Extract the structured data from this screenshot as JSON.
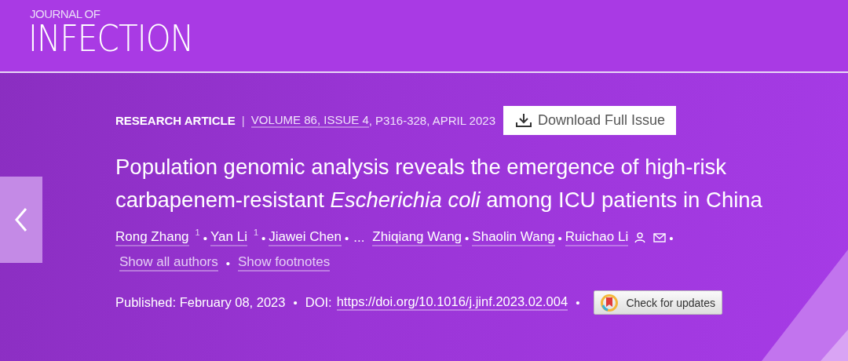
{
  "journal": {
    "small": "JOURNAL OF",
    "name": "INFECTION"
  },
  "article": {
    "type": "RESEARCH ARTICLE",
    "separator": "|",
    "issue": "VOLUME 86, ISSUE 4",
    "pages": ", P316-328, APRIL 2023",
    "download": "Download Full Issue",
    "title": "Population genomic analysis reveals the emergence of high-risk carbapenem-resistant *Escherichia coli* among ICU patients in China",
    "authors": [
      {
        "kind": "author",
        "name": "Rong Zhang",
        "note": "1",
        "after": "•"
      },
      {
        "kind": "author",
        "name": "Yan Li",
        "note": "1",
        "after": "•"
      },
      {
        "kind": "author",
        "name": "Jiawei Chen",
        "after": "•"
      },
      {
        "kind": "ellipsis",
        "name": "..."
      },
      {
        "kind": "author",
        "name": "Zhiqiang Wang",
        "after": "•"
      },
      {
        "kind": "author",
        "name": "Shaolin Wang",
        "after": "•"
      },
      {
        "kind": "author",
        "name": "Ruichao Li",
        "contact": true,
        "after": "•"
      }
    ],
    "links": [
      {
        "label": "Show all authors",
        "after": "•"
      },
      {
        "label": "Show footnotes"
      }
    ],
    "published": "Published: February 08, 2023",
    "published_after": "•",
    "doi_label": "DOI:",
    "doi": "https://doi.org/10.1016/j.jinf.2023.02.004",
    "doi_after": "•",
    "updates": "Check for updates"
  }
}
